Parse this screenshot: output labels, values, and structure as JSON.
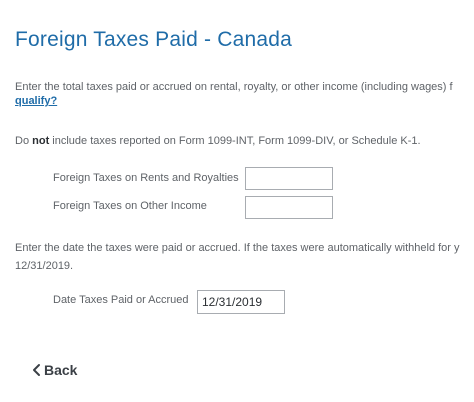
{
  "page": {
    "title": "Foreign Taxes Paid - Canada"
  },
  "intro": {
    "line": "Enter the total taxes paid or accrued on rental, royalty, or other income (including wages) f",
    "link": "qualify?"
  },
  "note": {
    "prefix": "Do ",
    "bold": "not",
    "suffix": " include taxes reported on Form 1099-INT, Form 1099-DIV, or Schedule K-1."
  },
  "fields": {
    "rents_label": "Foreign Taxes on Rents and Royalties",
    "rents_value": "",
    "other_label": "Foreign Taxes on Other Income",
    "other_value": ""
  },
  "date_section": {
    "line1": "Enter the date the taxes were paid or accrued. If the taxes were automatically withheld for y",
    "line2": "12/31/2019.",
    "label": "Date Taxes Paid or Accrued",
    "value": "12/31/2019"
  },
  "nav": {
    "back_label": "Back"
  }
}
